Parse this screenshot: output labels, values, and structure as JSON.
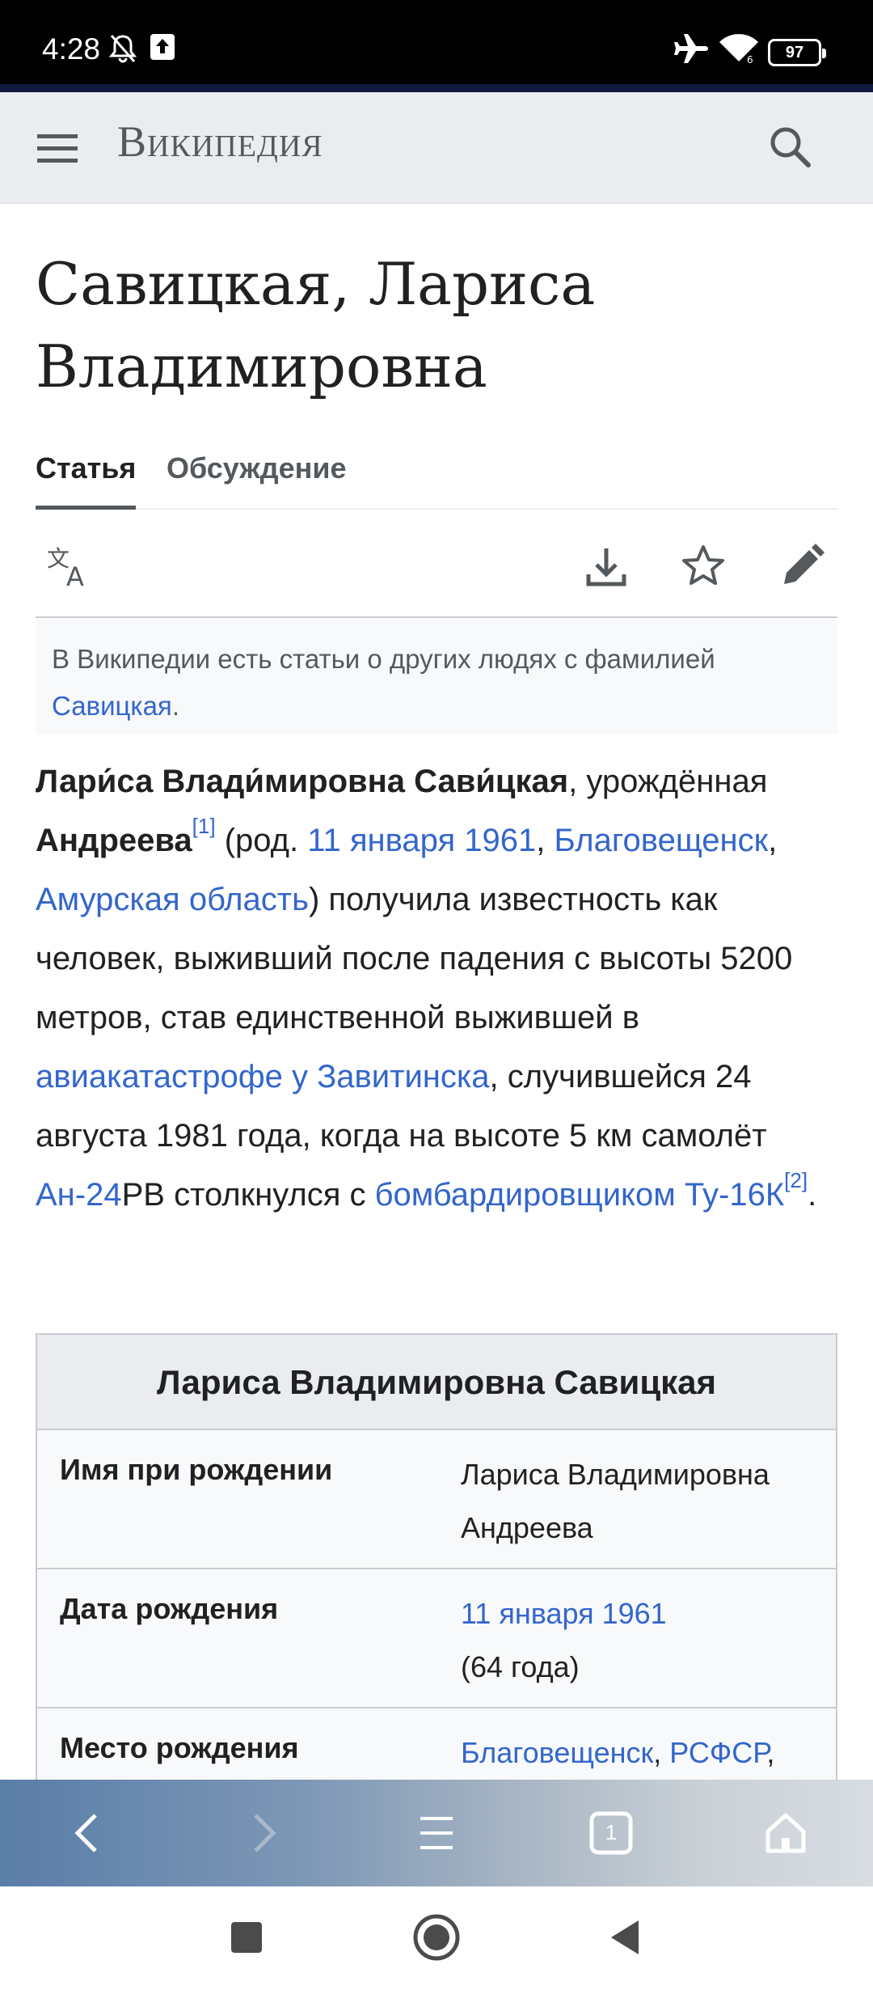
{
  "status_bar": {
    "time": "4:28",
    "battery": "97",
    "icons": [
      "mute-bell-icon",
      "upload-icon",
      "airplane-icon",
      "wifi-icon",
      "battery-icon"
    ]
  },
  "header": {
    "logo_text": "Википедия",
    "icons": [
      "menu-icon",
      "search-icon"
    ]
  },
  "article": {
    "title": "Савицкая, Лариса Владимировна",
    "tabs": [
      {
        "label": "Статья",
        "active": true
      },
      {
        "label": "Обсуждение",
        "active": false
      }
    ],
    "actions": [
      "language-icon",
      "download-icon",
      "star-icon",
      "edit-pencil-icon"
    ],
    "hatnote": {
      "text": "В Википедии есть статьи о других людях с фамилией",
      "link": "Савицкая",
      "end": "."
    },
    "lead": {
      "bold_name": "Лари́са Влади́мировна Сави́цкая",
      "t1": ", урождённая ",
      "bold_birthname": "Андреева",
      "ref1": "[1]",
      "t2": " (род. ",
      "link_date": "11 января 1961",
      "t3": ", ",
      "link_city": "Благовещенск",
      "t4": ", ",
      "link_region": "Амурская область",
      "t5": ") получила известность как человек, выживший после падения с высоты 5200 метров, став единственной выжившей в ",
      "link_crash": "авиакатастрофе у Завитинска",
      "t6": ", случившейся 24 августа 1981 года, когда на высоте 5 км самолёт ",
      "link_plane": "Ан-24",
      "t7": "РВ столкнулся с ",
      "link_bomber": "бомбардировщиком Ту-16К",
      "ref2": "[2]",
      "t8": "."
    },
    "infobox": {
      "title": "Лариса Владимировна Савицкая",
      "rows": [
        {
          "label": "Имя при рождении",
          "value": "Лариса Владимировна Андреева"
        },
        {
          "label": "Дата рождения",
          "value_link": "11 января 1961",
          "value_extra": "(64 года)"
        },
        {
          "label": "Место рождения",
          "value_link1": "Благовещенск",
          "value_sep": ", ",
          "value_link2": "РСФСР",
          "value_end": ","
        }
      ]
    }
  },
  "browser_toolbar": {
    "tab_count": "1",
    "icons": [
      "back-arrow-icon",
      "forward-arrow-icon",
      "hamburger-menu-icon",
      "tabs-icon",
      "home-icon"
    ]
  },
  "nav_bar": {
    "icons": [
      "recents-square-icon",
      "home-circle-icon",
      "back-triangle-icon"
    ]
  }
}
